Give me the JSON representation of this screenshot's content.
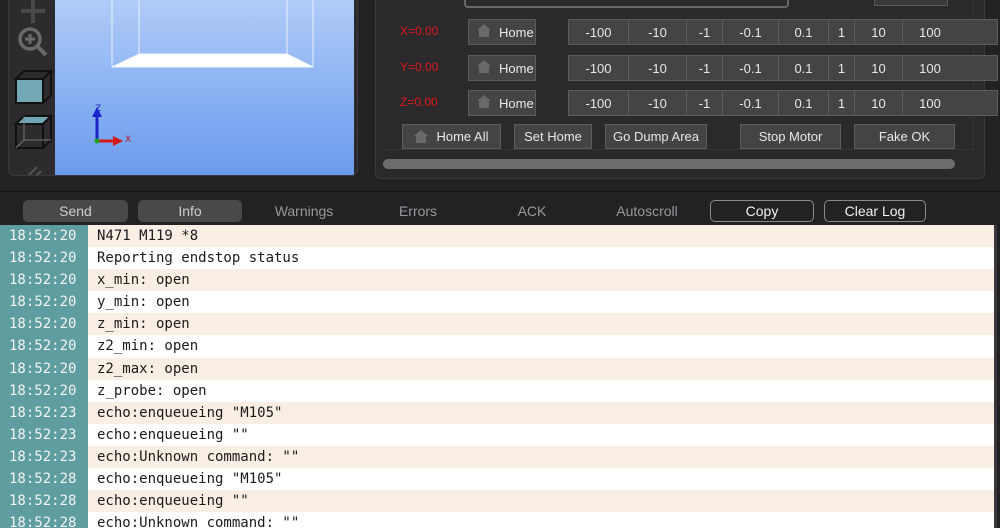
{
  "view": {
    "tools": [
      "move-icon",
      "zoom-in-icon",
      "front-view-cube-icon",
      "top-view-cube-icon",
      "resize-grip-icon"
    ],
    "axis_x_label": "X",
    "axis_z_label": "Z"
  },
  "control": {
    "axes": [
      {
        "label": "X=0.00",
        "home_label": "Home"
      },
      {
        "label": "Y=0.00",
        "home_label": "Home"
      },
      {
        "label": "Z=0.00",
        "home_label": "Home"
      }
    ],
    "jog_steps": [
      "-100",
      "-10",
      "-1",
      "-0.1",
      "0.1",
      "1",
      "10",
      "100"
    ],
    "actions": {
      "home_all": "Home All",
      "set_home": "Set Home",
      "go_dump_area": "Go Dump Area",
      "stop_motor": "Stop Motor",
      "fake_ok": "Fake OK"
    },
    "colors": {
      "position_label": "#e0191b"
    }
  },
  "log_tabs": {
    "send": "Send",
    "info": "Info",
    "warnings": "Warnings",
    "errors": "Errors",
    "ack": "ACK",
    "autoscroll": "Autoscroll",
    "copy": "Copy",
    "clear_log": "Clear Log"
  },
  "log": [
    {
      "time": "18:52:20",
      "message": "N471 M119 *8"
    },
    {
      "time": "18:52:20",
      "message": "Reporting endstop status"
    },
    {
      "time": "18:52:20",
      "message": "x_min: open"
    },
    {
      "time": "18:52:20",
      "message": "y_min: open"
    },
    {
      "time": "18:52:20",
      "message": "z_min: open"
    },
    {
      "time": "18:52:20",
      "message": "z2_min: open"
    },
    {
      "time": "18:52:20",
      "message": "z2_max: open"
    },
    {
      "time": "18:52:20",
      "message": "z_probe: open"
    },
    {
      "time": "18:52:23",
      "message": "echo:enqueueing \"M105\""
    },
    {
      "time": "18:52:23",
      "message": "echo:enqueueing \"\""
    },
    {
      "time": "18:52:23",
      "message": "echo:Unknown command: \"\""
    },
    {
      "time": "18:52:28",
      "message": "echo:enqueueing \"M105\""
    },
    {
      "time": "18:52:28",
      "message": "echo:enqueueing \"\""
    },
    {
      "time": "18:52:28",
      "message": "echo:Unknown command: \"\""
    }
  ]
}
